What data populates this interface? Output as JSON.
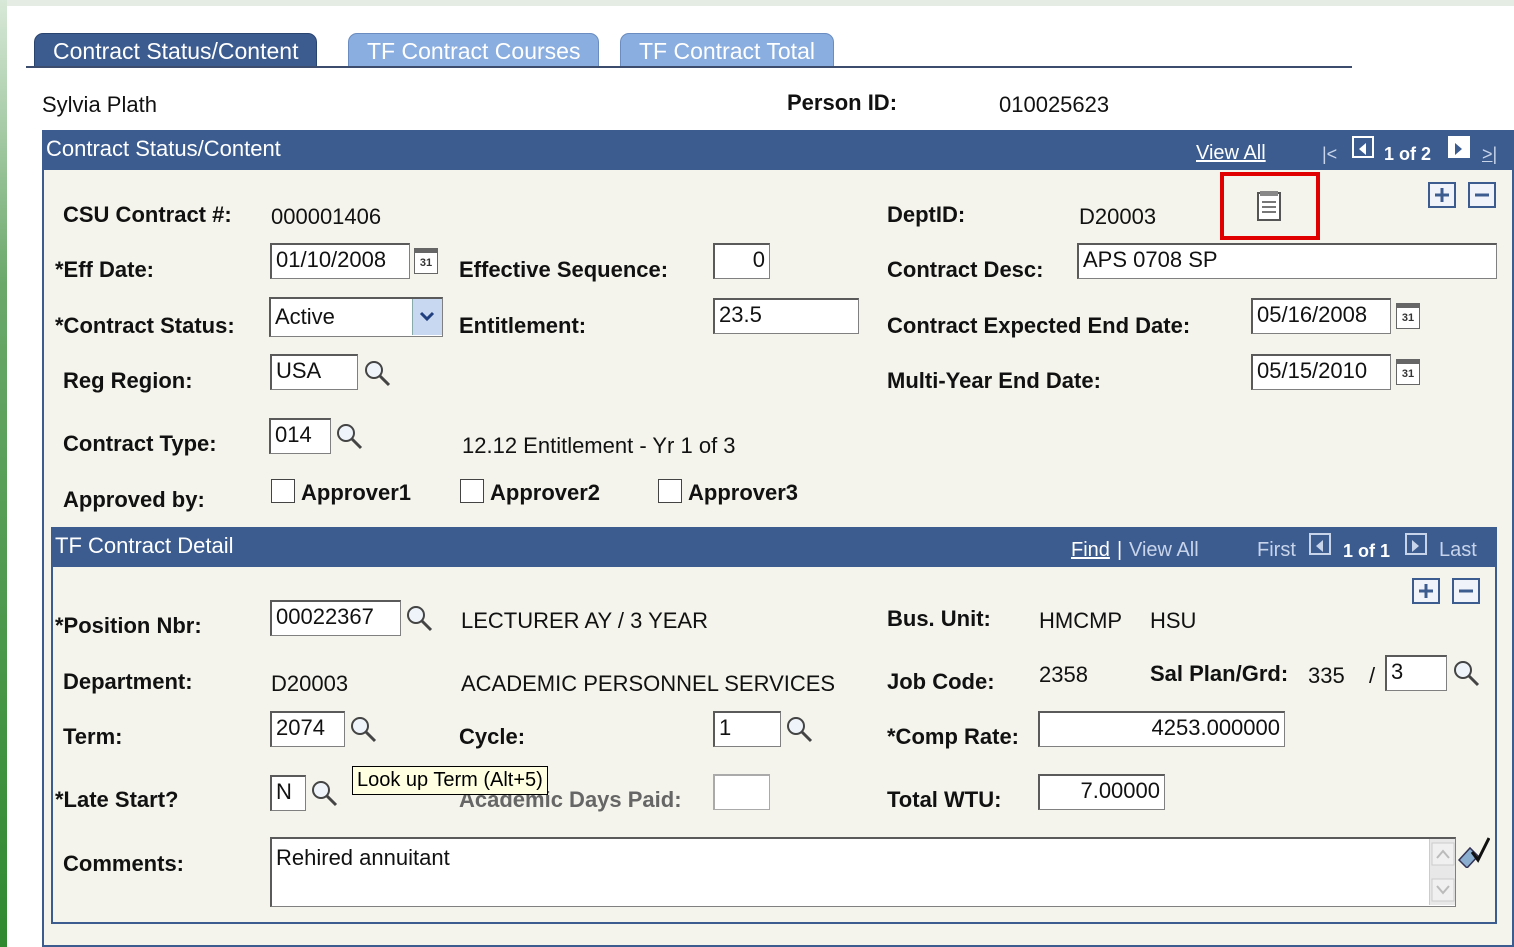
{
  "tabs": [
    {
      "label": "Contract Status/Content"
    },
    {
      "label": "TF Contract Courses"
    },
    {
      "label": "TF Contract Total"
    }
  ],
  "person": {
    "name": "Sylvia Plath",
    "id_label": "Person ID:",
    "id_value": "010025623"
  },
  "contract_panel": {
    "title": "Contract Status/Content",
    "view_all": "View All",
    "first_glyph": "|<",
    "count": "1 of 2",
    "last_glyph": ">|",
    "csu_label": "CSU Contract #:",
    "csu_value": "000001406",
    "dept_label": "DeptID:",
    "dept_value": "D20003",
    "eff_date_label": "*Eff Date:",
    "eff_date_value": "01/10/2008",
    "eff_seq_label": "Effective Sequence:",
    "eff_seq_value": "0",
    "contract_desc_label": "Contract Desc:",
    "contract_desc_value": "APS 0708 SP",
    "status_label": "*Contract Status:",
    "status_value": "Active",
    "entitlement_label": "Entitlement:",
    "entitlement_value": "23.5",
    "expected_end_label": "Contract Expected End Date:",
    "expected_end_value": "05/16/2008",
    "reg_region_label": "Reg Region:",
    "reg_region_value": "USA",
    "multi_year_label": "Multi-Year End Date:",
    "multi_year_value": "05/15/2010",
    "type_label": "Contract Type:",
    "type_value": "014",
    "type_desc": "12.12 Entitlement - Yr 1 of 3",
    "approved_label": "Approved by:",
    "approvers": [
      "Approver1",
      "Approver2",
      "Approver3"
    ],
    "cal_text": "31"
  },
  "detail_panel": {
    "title": "TF Contract Detail",
    "find": "Find",
    "sep": "|",
    "view_all": "View All",
    "first": "First",
    "count": "1 of 1",
    "last": "Last",
    "position_label": "*Position Nbr:",
    "position_value": "00022367",
    "position_desc": "LECTURER AY / 3 YEAR",
    "bus_unit_label": "Bus. Unit:",
    "bus_unit_value": "HMCMP",
    "bus_unit_desc": "HSU",
    "department_label": "Department:",
    "department_value": "D20003",
    "department_desc": "ACADEMIC PERSONNEL SERVICES",
    "job_code_label": "Job Code:",
    "job_code_value": "2358",
    "sal_plan_label": "Sal Plan/Grd:",
    "sal_plan_value": "335",
    "sal_sep": "/",
    "sal_grade_value": "3",
    "term_label": "Term:",
    "term_value": "2074",
    "cycle_label": "Cycle:",
    "cycle_value": "1",
    "comp_rate_label": "*Comp Rate:",
    "comp_rate_value": "4253.000000",
    "late_start_label": "*Late Start?",
    "late_start_value": "N",
    "days_paid_label": "Academic Days Paid:",
    "total_wtu_label": "Total WTU:",
    "total_wtu_value": "7.00000",
    "comments_label": "Comments:",
    "comments_value": "Rehired annuitant"
  },
  "tooltip": "Look up Term (Alt+5)",
  "colors": {
    "header_blue": "#3c5c90",
    "tab_inactive": "#8aaee0",
    "panel_bg": "#f4f4ec",
    "highlight_red": "#e00000"
  }
}
